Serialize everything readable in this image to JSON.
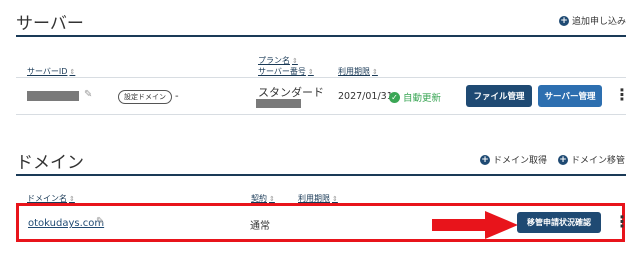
{
  "server": {
    "title": "サーバー",
    "add_label": "追加申し込み",
    "columns": {
      "server_id": "サーバーID",
      "plan_name": "プラン名",
      "server_number": "サーバー番号",
      "expiry": "利用期限"
    },
    "row": {
      "domain_setting_pill": "設定ドメイン",
      "domain_value": "-",
      "plan": "スタンダード",
      "expiry": "2027/01/31",
      "auto_renew": "自動更新",
      "file_manage_button": "ファイル管理",
      "server_manage_button": "サーバー管理"
    }
  },
  "domain": {
    "title": "ドメイン",
    "acquire_label": "ドメイン取得",
    "transfer_label": "ドメイン移管",
    "columns": {
      "domain_name": "ドメイン名",
      "contract": "契約",
      "expiry": "利用期限"
    },
    "row": {
      "name": "otokudays.com",
      "contract": "通常",
      "status_button": "移管申請状況確認"
    }
  },
  "colors": {
    "accent": "#1f4a73",
    "highlight_red": "#e8141b",
    "success": "#3aa655"
  }
}
